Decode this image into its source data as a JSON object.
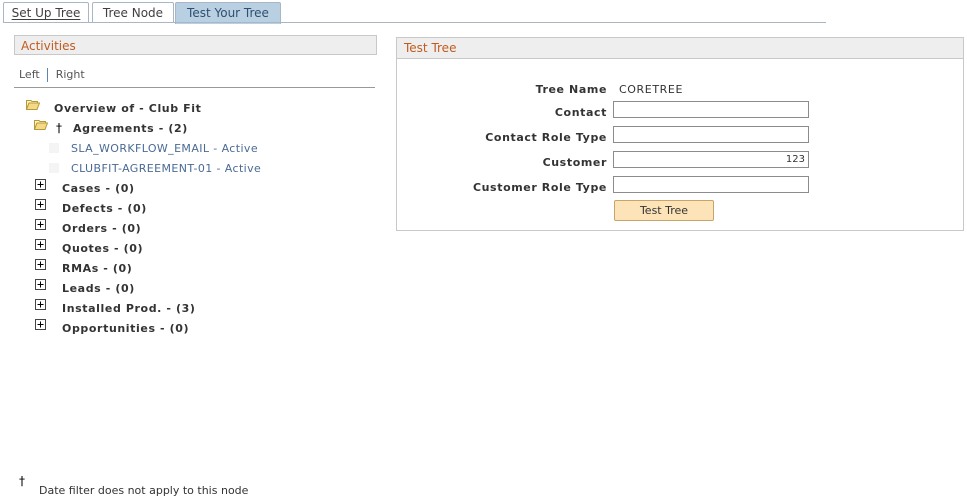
{
  "tabs": [
    {
      "label": "Set Up Tree",
      "active": false
    },
    {
      "label": "Tree Node",
      "active": false
    },
    {
      "label": "Test Your Tree",
      "active": true
    }
  ],
  "left_panel": {
    "title": "Activities",
    "left_label": "Left",
    "right_label": "Right",
    "root": "Overview of - Club Fit",
    "agreements": {
      "label": "Agreements - (2)",
      "dagger": "†",
      "children": [
        "SLA_WORKFLOW_EMAIL - Active",
        "CLUBFIT-AGREEMENT-01 - Active"
      ]
    },
    "nodes": [
      "Cases - (0)",
      "Defects - (0)",
      "Orders - (0)",
      "Quotes - (0)",
      "RMAs - (0)",
      "Leads - (0)",
      "Installed Prod. - (3)",
      "Opportunities - (0)"
    ]
  },
  "right_panel": {
    "title": "Test Tree",
    "tree_name_label": "Tree Name",
    "tree_name_value": "CORETREE",
    "contact_label": "Contact",
    "contact_value": "",
    "contact_role_type_label": "Contact Role Type",
    "contact_role_type_value": "",
    "customer_label": "Customer",
    "customer_value": "123",
    "customer_role_type_label": "Customer Role Type",
    "customer_role_type_value": "",
    "test_button": "Test Tree"
  },
  "footnote": {
    "dagger": "†",
    "text": "Date filter does not apply to this node"
  },
  "colors": {
    "section_title": "#c25b1f",
    "active_tab": "#b9cfe2",
    "link": "#4a6a94",
    "button": "#fce4b8"
  }
}
